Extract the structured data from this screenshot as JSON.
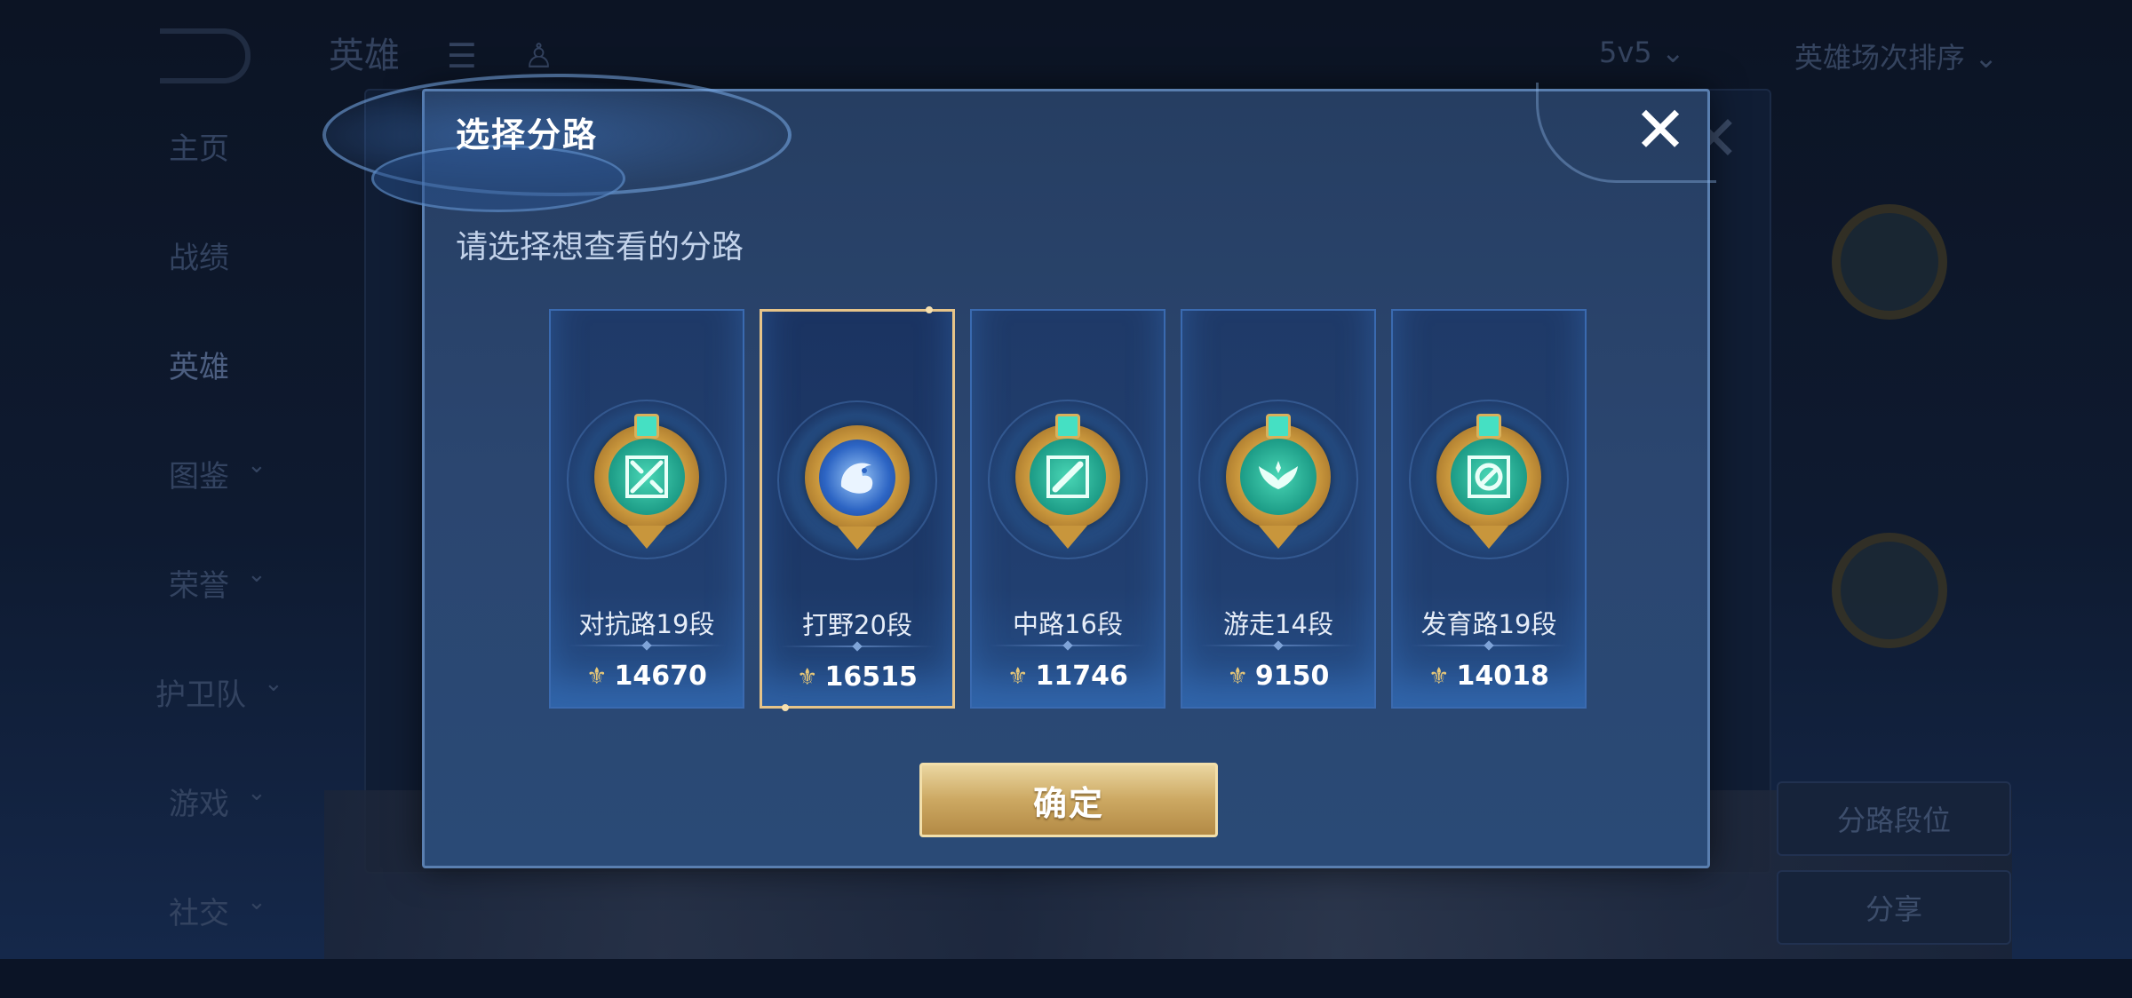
{
  "background": {
    "header_title": "英雄",
    "mode_select": "5v5",
    "sort_select": "英雄场次排序",
    "nav_items": [
      {
        "label": "主页",
        "has_chevron": false
      },
      {
        "label": "战绩",
        "has_chevron": false
      },
      {
        "label": "英雄",
        "has_chevron": false
      },
      {
        "label": "图鉴",
        "has_chevron": true
      },
      {
        "label": "荣誉",
        "has_chevron": true
      },
      {
        "label": "护卫队",
        "has_chevron": true
      },
      {
        "label": "游戏",
        "has_chevron": true
      },
      {
        "label": "社交",
        "has_chevron": true
      }
    ],
    "right_buttons": [
      "分路段位",
      "分享"
    ]
  },
  "dialog": {
    "title": "选择分路",
    "subtitle": "请选择想查看的分路",
    "close_icon": "close-icon",
    "confirm_label": "确定",
    "selected_index": 1,
    "lanes": [
      {
        "label": "对抗路19段",
        "score": "14670",
        "icon": "clash-lane-icon",
        "emblem_color": "teal"
      },
      {
        "label": "打野20段",
        "score": "16515",
        "icon": "jungle-dragon-icon",
        "emblem_color": "blue"
      },
      {
        "label": "中路16段",
        "score": "11746",
        "icon": "mid-lane-icon",
        "emblem_color": "teal"
      },
      {
        "label": "游走14段",
        "score": "9150",
        "icon": "roam-wings-icon",
        "emblem_color": "teal"
      },
      {
        "label": "发育路19段",
        "score": "14018",
        "icon": "farm-lane-icon",
        "emblem_color": "teal"
      }
    ]
  },
  "colors": {
    "accent_gold": "#e6c489",
    "dialog_bg": "#2b4670",
    "lane_border": "#3a6ab0"
  }
}
